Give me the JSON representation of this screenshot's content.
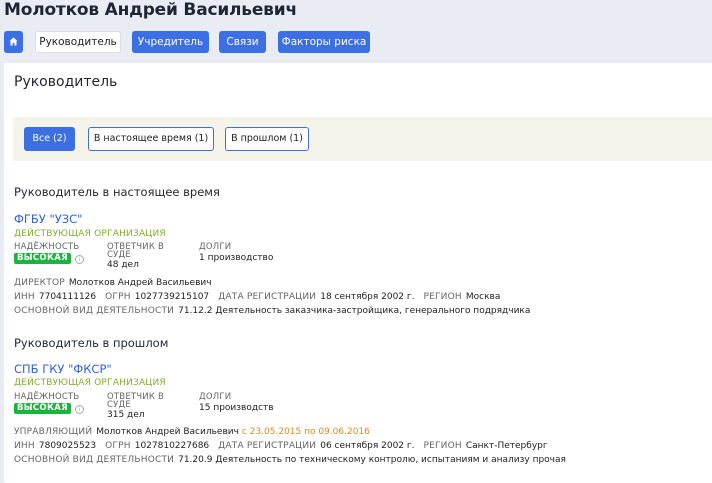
{
  "person": {
    "name": "Молотков Андрей Васильевич"
  },
  "tabs": [
    {
      "label": ""
    },
    {
      "label": "Руководитель"
    },
    {
      "label": "Учредитель"
    },
    {
      "label": "Связи"
    },
    {
      "label": "Факторы риска"
    }
  ],
  "panel": {
    "title": "Руководитель",
    "filters": [
      "Все (2)",
      "В настоящее время (1)",
      "В прошлом (1)"
    ]
  },
  "labels": {
    "reliability": "НАДЁЖНОСТЬ",
    "defendant1": "ОТВЕТЧИК В",
    "defendant2": "СУДЕ",
    "debts": "ДОЛГИ",
    "inn": "ИНН",
    "ogrn": "ОГРН",
    "reg_date": "ДАТА РЕГИСТРАЦИИ",
    "region": "РЕГИОН",
    "activity": "ОСНОВНОЙ ВИД ДЕЯТЕЛЬНОСТИ"
  },
  "current": {
    "section_title": "Руководитель в настоящее время",
    "org_name": "ФГБУ \"УЗС\"",
    "status": "ДЕЙСТВУЮЩАЯ ОРГАНИЗАЦИЯ",
    "reliability": "ВЫСОКАЯ",
    "court_cases": "48 дел",
    "debts": "1 производство",
    "role": "ДИРЕКТОР",
    "person": "Молотков Андрей Васильевич",
    "inn": "7704111126",
    "ogrn": "1027739215107",
    "reg_date": "18 сентября 2002 г.",
    "region": "Москва",
    "activity": "71.12.2 Деятельность заказчика-застройщика, генерального подрядчика"
  },
  "past": {
    "section_title": "Руководитель в прошлом",
    "org_name": "СПБ ГКУ \"ФКСР\"",
    "status": "ДЕЙСТВУЮЩАЯ ОРГАНИЗАЦИЯ",
    "reliability": "ВЫСОКАЯ",
    "court_cases": "315 дел",
    "debts": "15 производств",
    "role": "УПРАВЛЯЮЩИЙ",
    "person": "Молотков Андрей Васильевич",
    "period": "с 23.05.2015 по 09.06.2016",
    "inn": "7809025523",
    "ogrn": "1027810227686",
    "reg_date": "06 сентября 2002 г.",
    "region": "Санкт-Петербург",
    "activity": "71.20.9 Деятельность по техническому контролю, испытаниям и анализу прочая"
  },
  "colors": {
    "accent": "#3c6fe4",
    "link": "#2f62d8",
    "status_green": "#7fae2c",
    "badge_green": "#1bb43d",
    "period_orange": "#e0891b"
  },
  "icons": {
    "home": "home-icon",
    "info": "info-icon"
  }
}
